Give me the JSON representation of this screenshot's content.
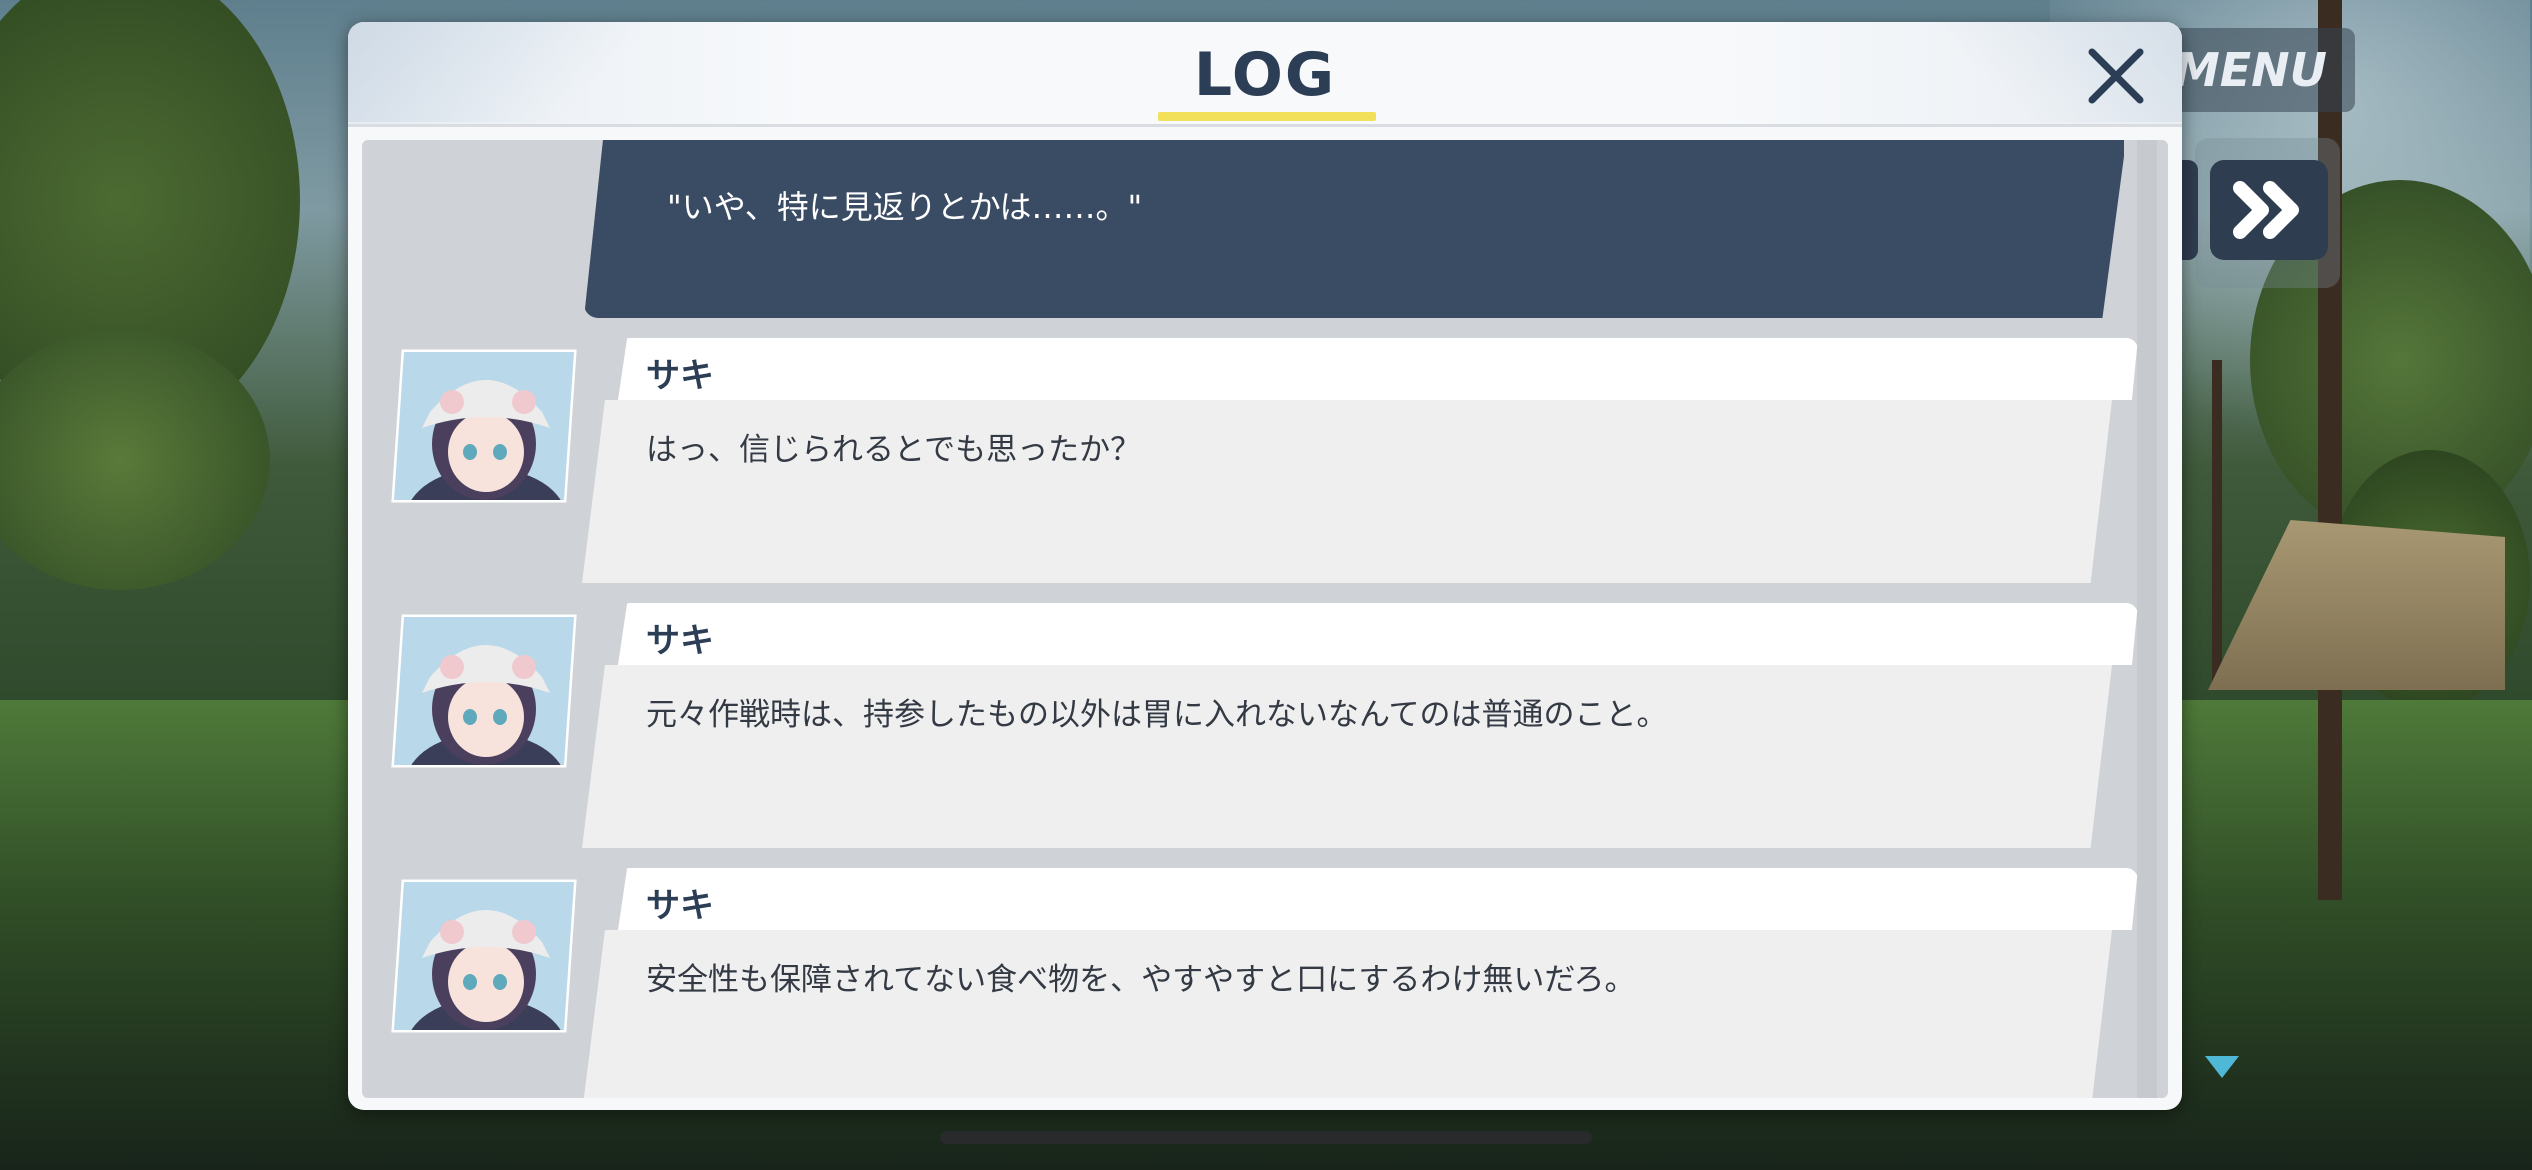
{
  "window": {
    "title": "LOG"
  },
  "hud": {
    "menu_label": "MENU"
  },
  "log": {
    "choice_text": "\"いや、特に見返りとかは……。\"",
    "entries": [
      {
        "speaker": "サキ",
        "text": "はっ、信じられるとでも思ったか？"
      },
      {
        "speaker": "サキ",
        "text": "元々作戦時は、持参したもの以外は胃に入れないなんてのは普通のこと。"
      },
      {
        "speaker": "サキ",
        "text": "安全性も保障されてない食べ物を、やすやすと口にするわけ無いだろ。"
      }
    ]
  },
  "icons": {
    "close": "close-icon",
    "fast_forward": "fast-forward-icon",
    "scroll_down": "triangle-down-icon"
  },
  "colors": {
    "title": "#2c3e56",
    "title_underline": "#f3e05a",
    "choice_bubble": "#3a4b64",
    "dialogue_bubble": "#efefef",
    "panel": "#f7f8fa"
  }
}
